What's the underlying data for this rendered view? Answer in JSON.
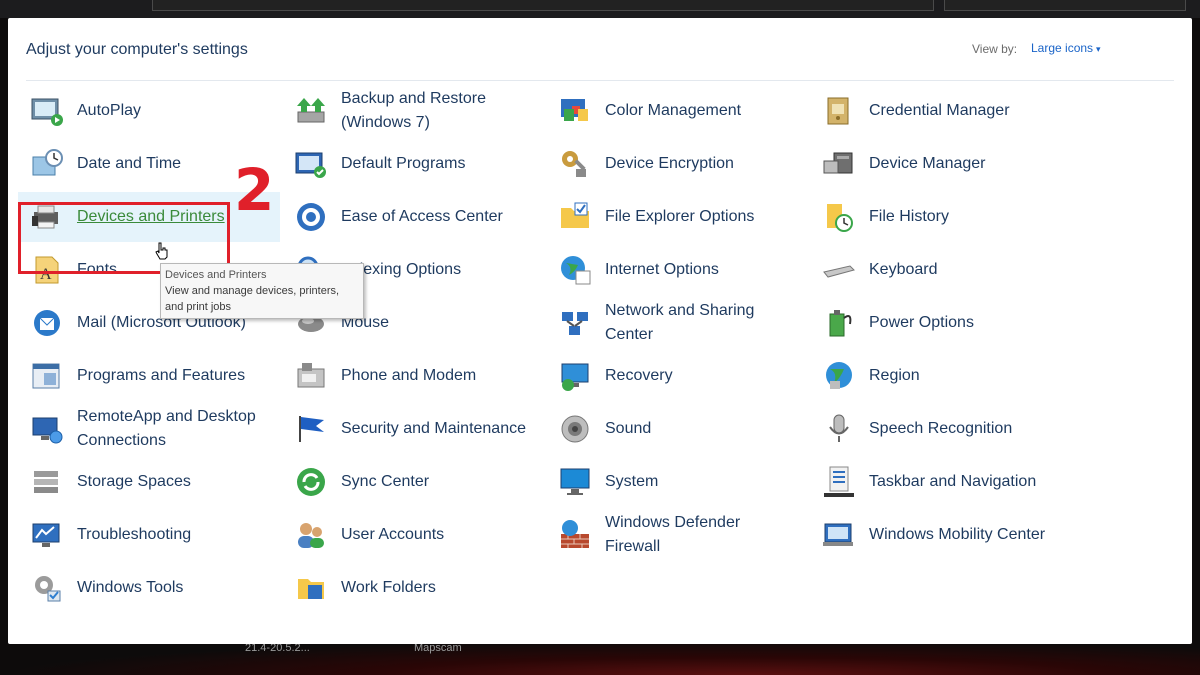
{
  "header": {
    "title": "Adjust your computer's settings",
    "view_by_label": "View by:",
    "view_by_value": "Large icons"
  },
  "annotation": {
    "step": "2"
  },
  "tooltip": {
    "title": "Devices and Printers",
    "description": "View and manage devices, printers, and print jobs"
  },
  "desktop": {
    "label_a": "21.4-20.5.2...",
    "label_b": "Mapscam"
  },
  "items": [
    {
      "label": "AutoPlay",
      "icon": "autoplay-icon"
    },
    {
      "label": "Date and Time",
      "icon": "clock-icon"
    },
    {
      "label": "Devices and Printers",
      "icon": "printer-icon"
    },
    {
      "label": "Fonts",
      "icon": "fonts-icon"
    },
    {
      "label": "Mail (Microsoft Outlook)",
      "icon": "mail-icon"
    },
    {
      "label": "Programs and Features",
      "icon": "programs-icon"
    },
    {
      "label": "RemoteApp and Desktop Connections",
      "icon": "remote-desktop-icon"
    },
    {
      "label": "Storage Spaces",
      "icon": "storage-icon"
    },
    {
      "label": "Troubleshooting",
      "icon": "troubleshoot-icon"
    },
    {
      "label": "Windows Tools",
      "icon": "tools-icon"
    },
    {
      "label": "Backup and Restore (Windows 7)",
      "icon": "backup-icon"
    },
    {
      "label": "Default Programs",
      "icon": "default-programs-icon"
    },
    {
      "label": "Ease of Access Center",
      "icon": "ease-of-access-icon"
    },
    {
      "label": "Indexing Options",
      "icon": "indexing-icon"
    },
    {
      "label": "Mouse",
      "icon": "mouse-icon"
    },
    {
      "label": "Phone and Modem",
      "icon": "phone-icon"
    },
    {
      "label": "Security and Maintenance",
      "icon": "flag-icon"
    },
    {
      "label": "Sync Center",
      "icon": "sync-icon"
    },
    {
      "label": "User Accounts",
      "icon": "users-icon"
    },
    {
      "label": "Work Folders",
      "icon": "work-folders-icon"
    },
    {
      "label": "Color Management",
      "icon": "color-icon"
    },
    {
      "label": "Device Encryption",
      "icon": "encryption-icon"
    },
    {
      "label": "File Explorer Options",
      "icon": "folder-options-icon"
    },
    {
      "label": "Internet Options",
      "icon": "globe-icon"
    },
    {
      "label": "Network and Sharing Center",
      "icon": "network-icon"
    },
    {
      "label": "Recovery",
      "icon": "recovery-icon"
    },
    {
      "label": "Sound",
      "icon": "speaker-icon"
    },
    {
      "label": "System",
      "icon": "monitor-icon"
    },
    {
      "label": "Windows Defender Firewall",
      "icon": "firewall-icon"
    },
    {
      "label": "Credential Manager",
      "icon": "credential-icon"
    },
    {
      "label": "Device Manager",
      "icon": "device-manager-icon"
    },
    {
      "label": "File History",
      "icon": "file-history-icon"
    },
    {
      "label": "Keyboard",
      "icon": "keyboard-icon"
    },
    {
      "label": "Power Options",
      "icon": "power-icon"
    },
    {
      "label": "Region",
      "icon": "region-icon"
    },
    {
      "label": "Speech Recognition",
      "icon": "microphone-icon"
    },
    {
      "label": "Taskbar and Navigation",
      "icon": "taskbar-icon"
    },
    {
      "label": "Windows Mobility Center",
      "icon": "mobility-icon"
    }
  ]
}
